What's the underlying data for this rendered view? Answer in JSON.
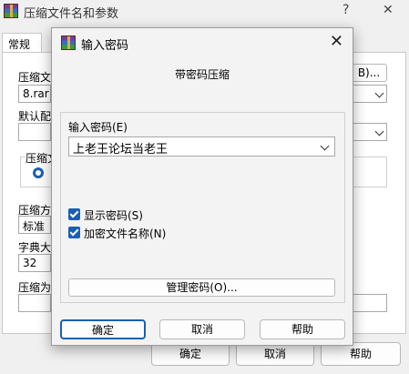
{
  "background_window": {
    "title": "压缩文件名和参数",
    "help": "?",
    "close": "✕",
    "tab_general": "常规",
    "label_archive_name": "压缩文",
    "archive_name_value": "8.rar",
    "browse_label": "B)...",
    "label_default_profile": "默认配",
    "label_compress_format": "压缩文",
    "label_compress_method": "压缩方",
    "method_value": "标准",
    "label_dict_size": "字典大",
    "dict_value": "32",
    "label_split": "压缩为",
    "ok": "确定",
    "cancel": "取消",
    "help_button": "帮助"
  },
  "dialog": {
    "title": "输入密码",
    "close": "✕",
    "heading": "带密码压缩",
    "password_label": "输入密码(E)",
    "password_value": "上老王论坛当老王",
    "show_password": "显示密码(S)",
    "encrypt_filenames": "加密文件名称(N)",
    "manage_passwords": "管理密码(O)...",
    "ok": "确定",
    "cancel": "取消",
    "help": "帮助"
  }
}
